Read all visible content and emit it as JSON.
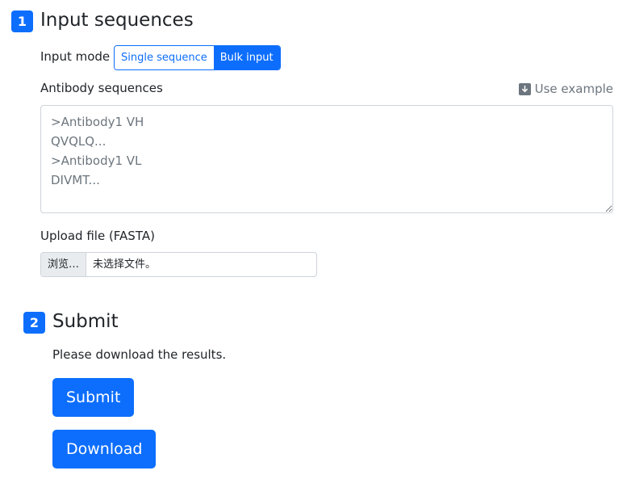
{
  "step1": {
    "number": "1",
    "title": "Input sequences",
    "mode_label": "Input mode",
    "modes": [
      {
        "label": "Single sequence",
        "active": false
      },
      {
        "label": "Bulk input",
        "active": true
      }
    ],
    "sequences_label": "Antibody sequences",
    "use_example": "Use example",
    "textarea_placeholder": ">Antibody1 VH\nQVQLQ...\n>Antibody1 VL\nDIVMT...",
    "upload_label": "Upload file (FASTA)",
    "file_browse": "浏览…",
    "file_status": "未选择文件。"
  },
  "step2": {
    "number": "2",
    "title": "Submit",
    "info": "Please download the results.",
    "submit_label": "Submit",
    "download_label": "Download"
  },
  "colors": {
    "primary": "#0d6efd",
    "muted": "#6c757d",
    "border": "#ced4da",
    "text": "#212529"
  }
}
